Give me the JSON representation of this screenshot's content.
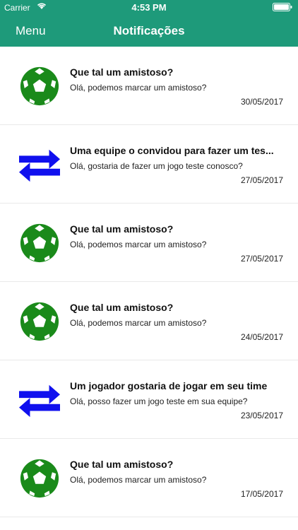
{
  "status": {
    "carrier": "Carrier",
    "time": "4:53 PM"
  },
  "nav": {
    "menu_label": "Menu",
    "title": "Notificações"
  },
  "colors": {
    "header": "#1e9a7a",
    "ball": "#1a8a1a",
    "arrows": "#1010ee"
  },
  "notifications": [
    {
      "icon": "soccer-ball-icon",
      "title": "Que tal um amistoso?",
      "message": "Olá, podemos marcar um amistoso?",
      "date": "30/05/2017"
    },
    {
      "icon": "swap-arrows-icon",
      "title": "Uma equipe o convidou para fazer um tes...",
      "message": "Olá, gostaria de fazer um jogo teste conosco?",
      "date": "27/05/2017"
    },
    {
      "icon": "soccer-ball-icon",
      "title": "Que tal um amistoso?",
      "message": "Olá, podemos marcar um amistoso?",
      "date": "27/05/2017"
    },
    {
      "icon": "soccer-ball-icon",
      "title": "Que tal um amistoso?",
      "message": "Olá, podemos marcar um amistoso?",
      "date": "24/05/2017"
    },
    {
      "icon": "swap-arrows-icon",
      "title": "Um jogador gostaria de jogar em seu time",
      "message": "Olá, posso fazer um jogo teste em sua equipe?",
      "date": "23/05/2017"
    },
    {
      "icon": "soccer-ball-icon",
      "title": "Que tal um amistoso?",
      "message": "Olá, podemos marcar um amistoso?",
      "date": "17/05/2017"
    }
  ]
}
